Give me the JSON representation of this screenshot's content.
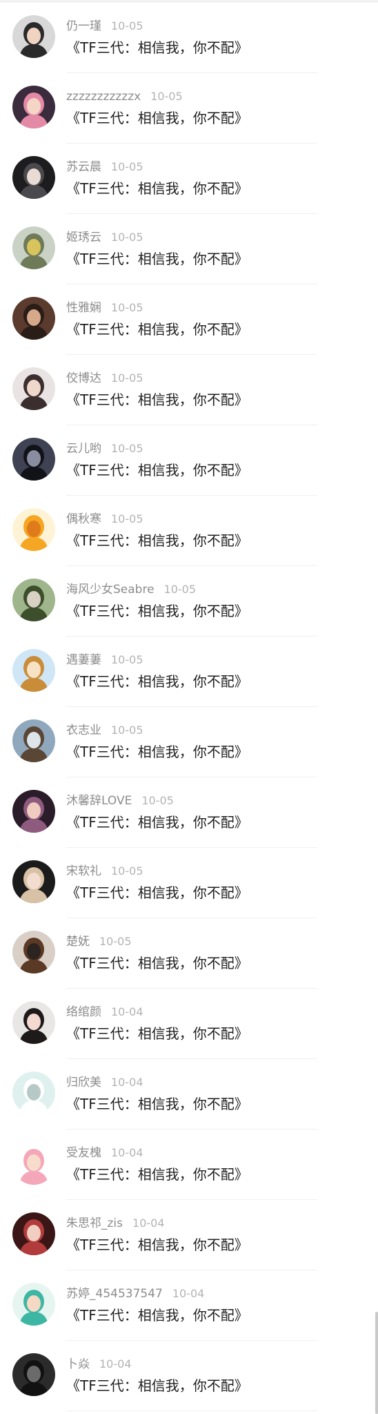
{
  "comments": [
    {
      "username": "仍一瑾",
      "date": "10-05",
      "text": "《TF三代：相信我，你不配》",
      "avatar_icon": "avatar-boy-dark",
      "avatar_colors": [
        "#d8d8d8",
        "#2a2a2a",
        "#f1d3c2"
      ]
    },
    {
      "username": "zzzzzzzzzzzx",
      "date": "10-05",
      "text": "《TF三代：相信我，你不配》",
      "avatar_icon": "avatar-anime-girl-pink",
      "avatar_colors": [
        "#3a2b3d",
        "#e58aa6",
        "#f5d6c6"
      ]
    },
    {
      "username": "苏云晨",
      "date": "10-05",
      "text": "《TF三代：相信我，你不配》",
      "avatar_icon": "avatar-dark-portrait",
      "avatar_colors": [
        "#1d1d1f",
        "#4a4a4e",
        "#e8dcd4"
      ]
    },
    {
      "username": "姬琇云",
      "date": "10-05",
      "text": "《TF三代：相信我，你不配》",
      "avatar_icon": "avatar-landscape-tree",
      "avatar_colors": [
        "#c9d2c5",
        "#6f7a58",
        "#d8c35c"
      ]
    },
    {
      "username": "性雅娴",
      "date": "10-05",
      "text": "《TF三代：相信我，你不配》",
      "avatar_icon": "avatar-sunglasses-girl",
      "avatar_colors": [
        "#5a3b2d",
        "#2a1d18",
        "#d7a98b"
      ]
    },
    {
      "username": "佼博达",
      "date": "10-05",
      "text": "《TF三代：相信我，你不配》",
      "avatar_icon": "avatar-girl-light",
      "avatar_colors": [
        "#e9e3e4",
        "#3b2e2e",
        "#f0d7cb"
      ]
    },
    {
      "username": "云儿哟",
      "date": "10-05",
      "text": "《TF三代：相信我，你不配》",
      "avatar_icon": "avatar-silhouette-night",
      "avatar_colors": [
        "#3f4252",
        "#111318",
        "#8a8da0"
      ]
    },
    {
      "username": "偶秋寒",
      "date": "10-05",
      "text": "《TF三代：相信我，你不配》",
      "avatar_icon": "avatar-cartoon-orange",
      "avatar_colors": [
        "#fff3d6",
        "#f5a623",
        "#e07b1b"
      ]
    },
    {
      "username": "海风少女Seabre",
      "date": "10-05",
      "text": "《TF三代：相信我，你不配》",
      "avatar_icon": "avatar-field-girl",
      "avatar_colors": [
        "#9fb58c",
        "#3d4e2c",
        "#d9d2c4"
      ]
    },
    {
      "username": "遇萋萋",
      "date": "10-05",
      "text": "《TF三代：相信我，你不配》",
      "avatar_icon": "avatar-cartoon-girl-blue",
      "avatar_colors": [
        "#cfe6f7",
        "#c98d3a",
        "#f7e2c6"
      ]
    },
    {
      "username": "衣志业",
      "date": "10-05",
      "text": "《TF三代：相信我，你不配》",
      "avatar_icon": "avatar-cat-sea",
      "avatar_colors": [
        "#8fa8bd",
        "#5a4634",
        "#dde5ea"
      ]
    },
    {
      "username": "沐馨辞LOVE",
      "date": "10-05",
      "text": "《TF三代：相信我，你不配》",
      "avatar_icon": "avatar-anime-dark",
      "avatar_colors": [
        "#2a1c28",
        "#8e5a7e",
        "#f0cbbf"
      ]
    },
    {
      "username": "宋软礼",
      "date": "10-05",
      "text": "《TF三代：相信我，你不配》",
      "avatar_icon": "avatar-blonde-portrait",
      "avatar_colors": [
        "#1c1b1b",
        "#d8c2a6",
        "#f2ddd0"
      ]
    },
    {
      "username": "楚妩",
      "date": "10-05",
      "text": "《TF三代：相信我，你不配》",
      "avatar_icon": "avatar-violin-girl",
      "avatar_colors": [
        "#d9cfc7",
        "#5b3a25",
        "#2c2420"
      ]
    },
    {
      "username": "络绾颜",
      "date": "10-04",
      "text": "《TF三代：相信我，你不配》",
      "avatar_icon": "avatar-longhair-girl",
      "avatar_colors": [
        "#e9e6e6",
        "#1e1a1a",
        "#f3d9cf"
      ]
    },
    {
      "username": "归欣美",
      "date": "10-04",
      "text": "《TF三代：相信我，你不配》",
      "avatar_icon": "avatar-white-bear",
      "avatar_colors": [
        "#dff1ee",
        "#ffffff",
        "#b7c9c6"
      ]
    },
    {
      "username": "受友槐",
      "date": "10-04",
      "text": "《TF三代：相信我，你不配》",
      "avatar_icon": "avatar-cartoon-nurse",
      "avatar_colors": [
        "#ffffff",
        "#f4a7b9",
        "#f7dccc"
      ]
    },
    {
      "username": "朱思祁_zis",
      "date": "10-04",
      "text": "《TF三代：相信我，你不配》",
      "avatar_icon": "avatar-red-portrait",
      "avatar_colors": [
        "#3a1616",
        "#b23b3b",
        "#f0cfc2"
      ]
    },
    {
      "username": "苏婷_454537547",
      "date": "10-04",
      "text": "《TF三代：相信我，你不配》",
      "avatar_icon": "avatar-cartoon-girl-teal",
      "avatar_colors": [
        "#e7f5f1",
        "#3db7a3",
        "#f5d9c4"
      ]
    },
    {
      "username": "卜焱",
      "date": "10-04",
      "text": "《TF三代：相信我，你不配》",
      "avatar_icon": "avatar-black-hat",
      "avatar_colors": [
        "#2b2b2b",
        "#111111",
        "#6b6b6b"
      ]
    }
  ]
}
